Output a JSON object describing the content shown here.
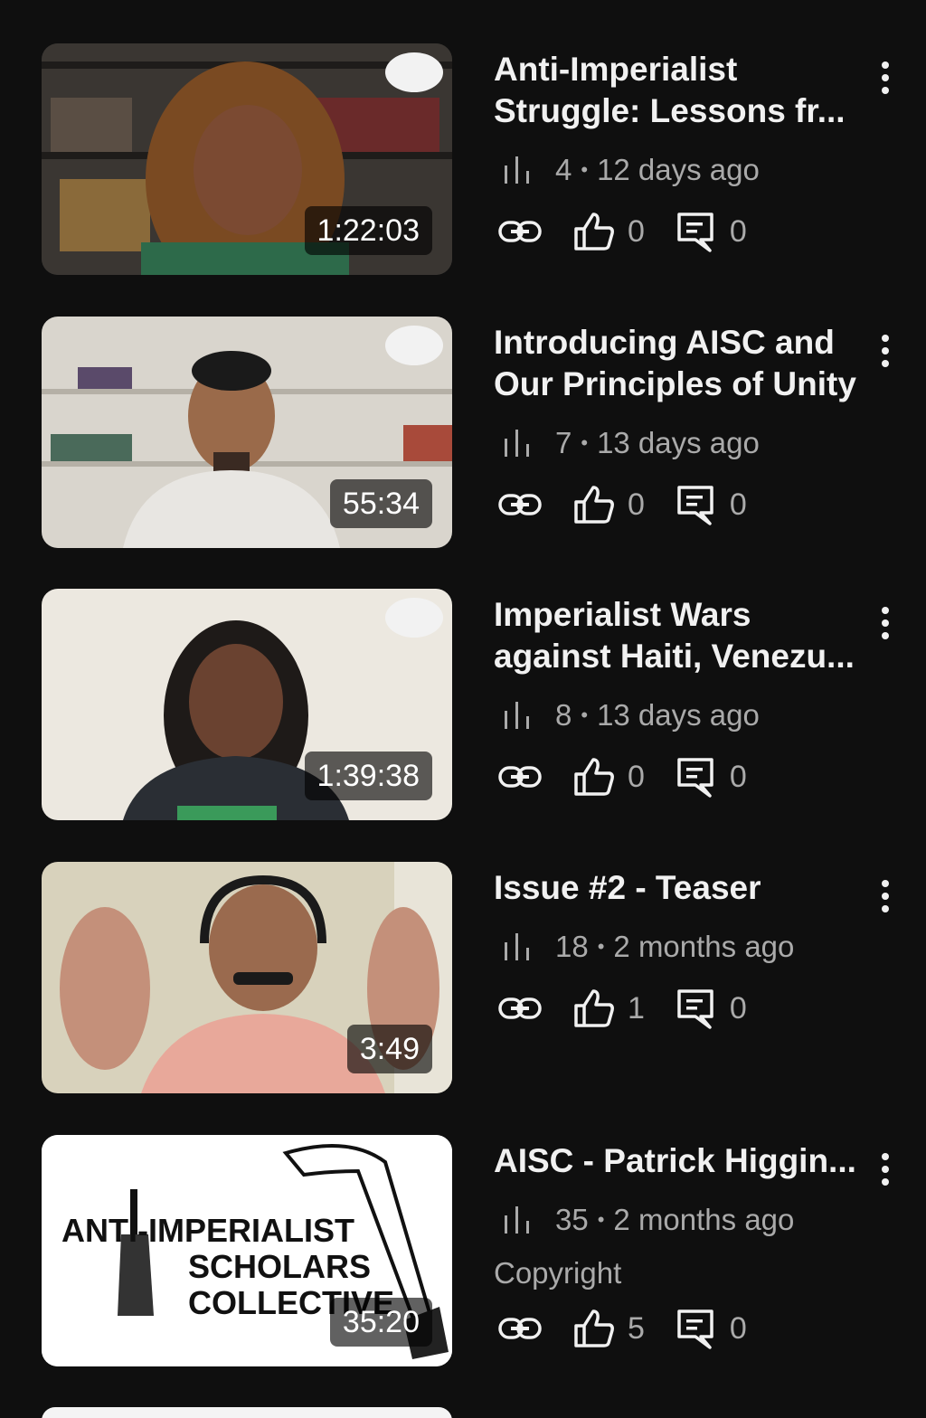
{
  "videos": [
    {
      "title": "Anti-Imperialist Struggle: Lessons fr...",
      "views": "4",
      "age": "12 days ago",
      "duration": "1:22:03",
      "likes": "0",
      "comments": "0"
    },
    {
      "title": "Introducing AISC and Our Principles of Unity",
      "views": "7",
      "age": "13 days ago",
      "duration": "55:34",
      "likes": "0",
      "comments": "0"
    },
    {
      "title": "Imperialist Wars against Haiti, Venezu...",
      "views": "8",
      "age": "13 days ago",
      "duration": "1:39:38",
      "likes": "0",
      "comments": "0"
    },
    {
      "title": "Issue #2 - Teaser",
      "views": "18",
      "age": "2 months ago",
      "duration": "3:49",
      "likes": "1",
      "comments": "0"
    },
    {
      "title": "AISC - Patrick Higgin...",
      "views": "35",
      "age": "2 months ago",
      "duration": "35:20",
      "likes": "5",
      "comments": "0",
      "copyright": "Copyright",
      "thumb_logo": {
        "line1": "ANTI-IMPERIALIST",
        "line2": "SCHOLARS",
        "line3": "COLLECTIVE"
      }
    }
  ],
  "stats_separator": "•",
  "icons": {
    "views": "bar-chart-icon",
    "link": "link-icon",
    "like": "thumbs-up-icon",
    "comment": "comment-icon",
    "menu": "more-vert-icon"
  },
  "colors": {
    "background": "#0f0f0f",
    "text_primary": "#f1f1f1",
    "text_secondary": "#aaaaaa"
  }
}
